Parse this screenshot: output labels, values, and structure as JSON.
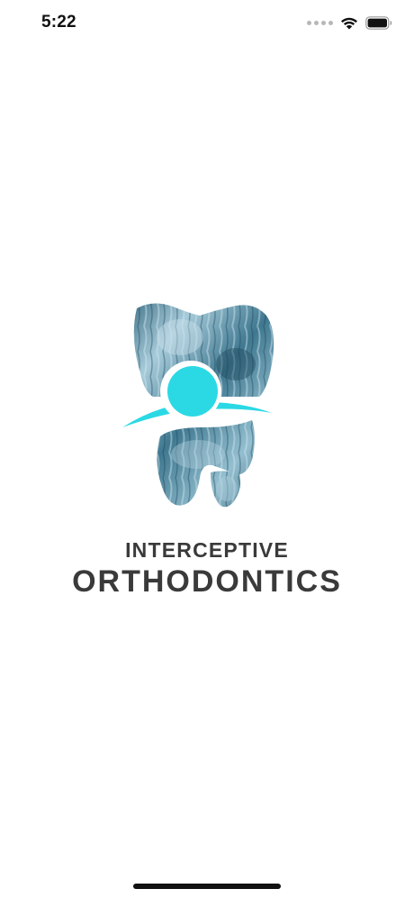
{
  "status_bar": {
    "time": "5:22",
    "icons": [
      "cellular-signal-icon",
      "wifi-icon",
      "battery-icon"
    ]
  },
  "splash": {
    "logo_icon": "tooth-logo-icon",
    "brand_line_1": "INTERCEPTIVE",
    "brand_line_2": "ORTHODONTICS",
    "colors": {
      "accent": "#2bd9e5",
      "xray_dark": "#2a5a70",
      "xray_light": "#9cc4d4",
      "text": "#3a3a3a"
    }
  }
}
